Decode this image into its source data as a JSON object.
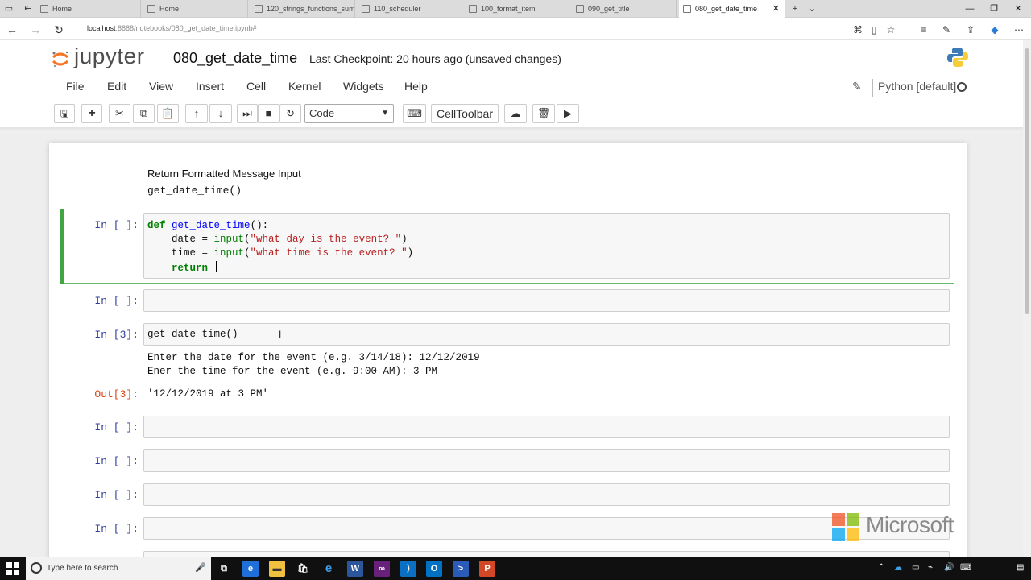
{
  "browser": {
    "tabs": [
      {
        "label": "Home",
        "active": false
      },
      {
        "label": "Home",
        "active": false
      },
      {
        "label": "120_strings_functions_sumn",
        "active": false
      },
      {
        "label": "110_scheduler",
        "active": false
      },
      {
        "label": "100_format_item",
        "active": false
      },
      {
        "label": "090_get_title",
        "active": false
      },
      {
        "label": "080_get_date_time",
        "active": true
      }
    ],
    "url_host": "localhost",
    "url_rest": ":8888/notebooks/080_get_date_time.ipynb#"
  },
  "jupyter": {
    "logo_text": "jupyter",
    "notebook_name": "080_get_date_time",
    "checkpoint": "Last Checkpoint: 20 hours ago (unsaved changes)",
    "menu": [
      "File",
      "Edit",
      "View",
      "Insert",
      "Cell",
      "Kernel",
      "Widgets",
      "Help"
    ],
    "kernel_name": "Python [default]",
    "cell_type": "Code",
    "celltoolbar_label": "CellToolbar"
  },
  "notebook": {
    "markdown": {
      "title": "Return Formatted Message Input",
      "code": "get_date_time()"
    },
    "cells": {
      "cell1_prompt": "In [ ]:",
      "cell2_prompt": "In [ ]:",
      "cell3_prompt": "In [3]:",
      "cell3_code": "get_date_time()",
      "cell3_stdout_1": "Enter the date for the event (e.g. 3/14/18): 12/12/2019",
      "cell3_stdout_2": "Ener the time for the event (e.g. 9:00 AM): 3 PM",
      "cell3_out_prompt": "Out[3]:",
      "cell3_out_value": "'12/12/2019 at 3 PM'",
      "cell4_prompt": "In [ ]:",
      "cell5_prompt": "In [ ]:",
      "cell6_prompt": "In [ ]:",
      "cell7_prompt": "In [ ]:"
    },
    "code": {
      "l1_kw": "def",
      "l1_fn": "get_date_time",
      "l1_rest": "():",
      "l2_a": "    date = ",
      "l2_bi": "input",
      "l2_b": "(",
      "l2_str": "\"what day is the event? \"",
      "l2_c": ")",
      "l3_a": "    time = ",
      "l3_bi": "input",
      "l3_b": "(",
      "l3_str": "\"what time is the event? \"",
      "l3_c": ")",
      "l4_a": "    ",
      "l4_kw": "return",
      "l4_b": " "
    }
  },
  "watermark": {
    "text": "Microsoft",
    "colors": [
      "#f25022",
      "#7fba00",
      "#00a4ef",
      "#ffb900"
    ]
  },
  "taskbar": {
    "search_placeholder": "Type here to search",
    "app_icons": [
      "ie-icon",
      "file-explorer-icon",
      "store-icon",
      "edge-icon",
      "word-icon",
      "visual-studio-icon",
      "vscode-icon",
      "outlook-icon",
      "powershell-icon",
      "powerpoint-icon"
    ]
  }
}
